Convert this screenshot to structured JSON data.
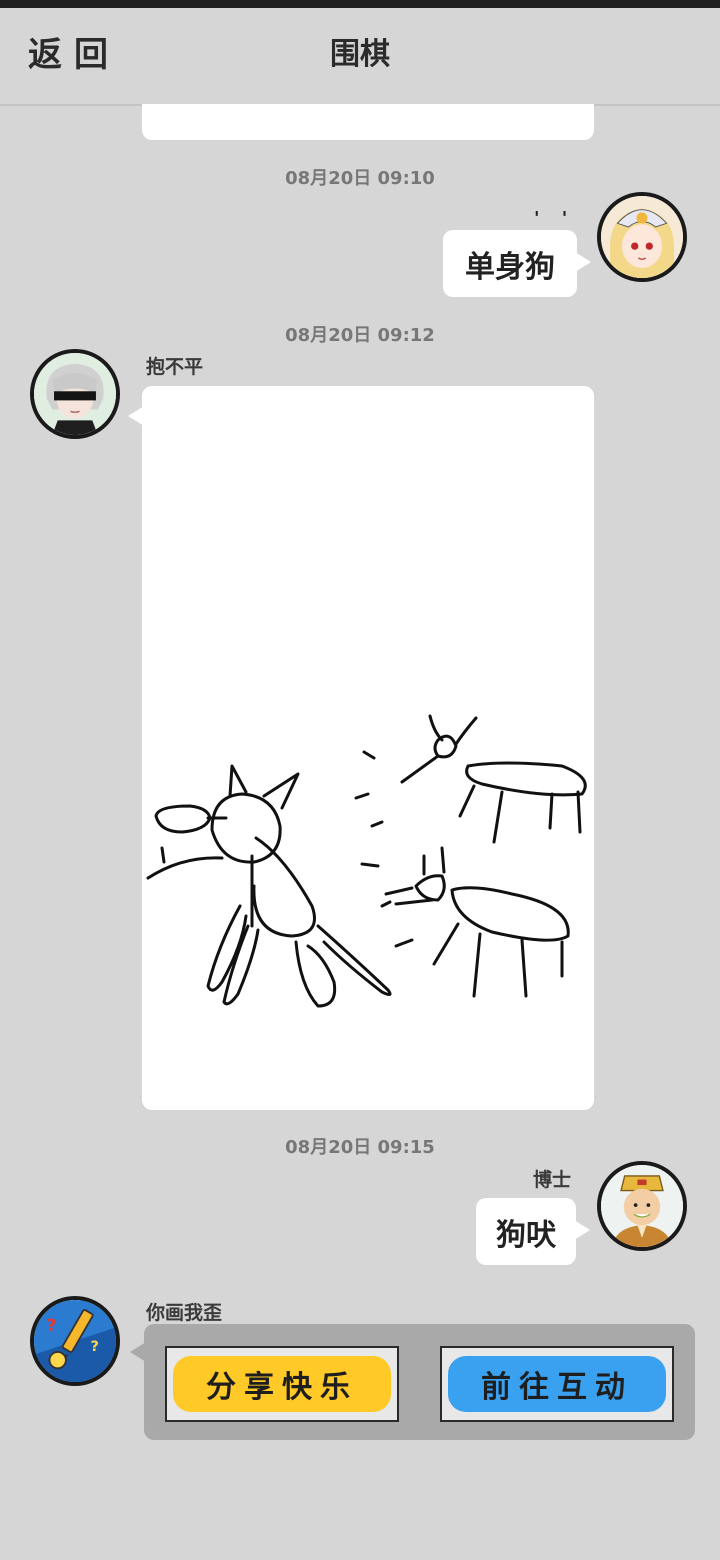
{
  "nav": {
    "back_label": "返回",
    "title": "围棋"
  },
  "messages": [
    {
      "timestamp": "08月20日 09:10",
      "text": "单身狗"
    },
    {
      "timestamp": "08月20日 09:12",
      "sender": "抱不平"
    },
    {
      "timestamp": "08月20日 09:15",
      "sender": "博士",
      "text": "狗吠"
    }
  ],
  "game_card": {
    "sender": "你画我歪",
    "share_label": "分享快乐",
    "interact_label": "前往互动"
  },
  "colors": {
    "background": "#d6d6d6",
    "share_button": "#ffc928",
    "interact_button": "#3aa0f0",
    "card_background": "#a9a9a9"
  }
}
